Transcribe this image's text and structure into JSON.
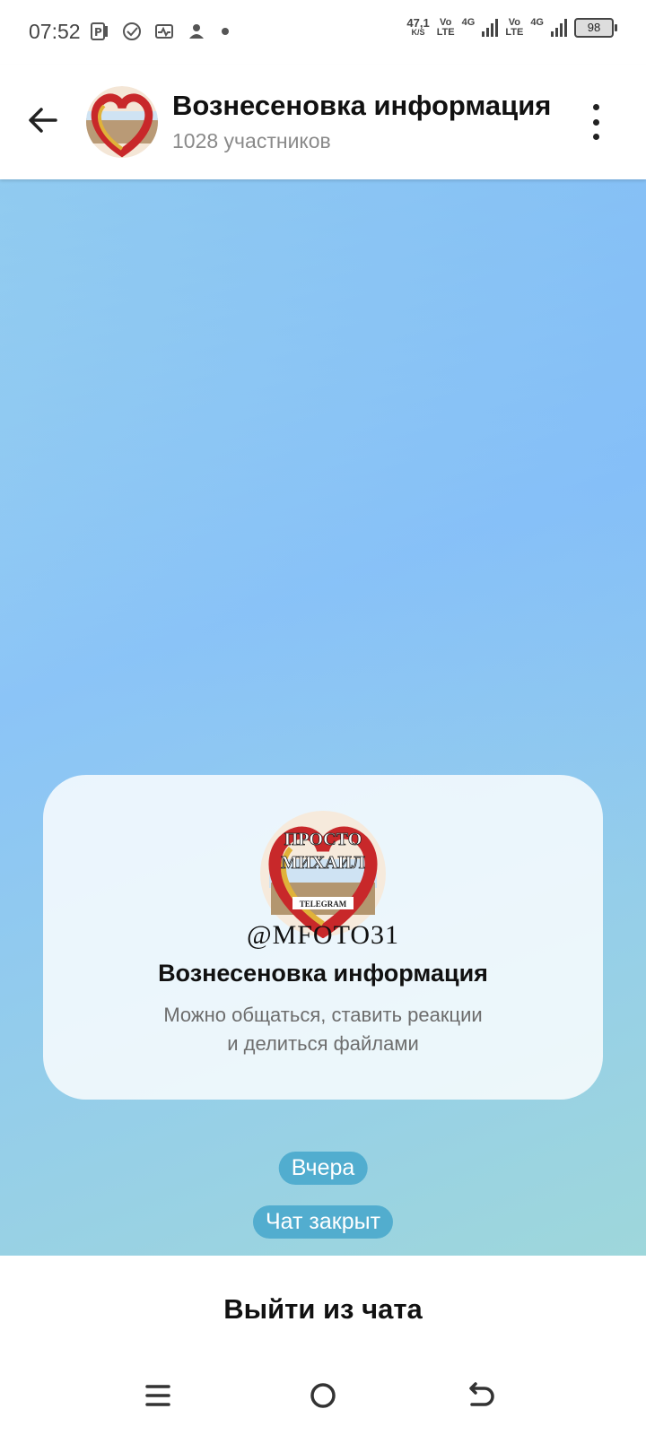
{
  "status_bar": {
    "time": "07:52",
    "net_speed_value": "47,1",
    "net_speed_unit": "K/S",
    "sim1_vo": "Vo",
    "sim1_lte": "LTE",
    "sim1_4g": "4G",
    "sim2_vo": "Vo",
    "sim2_lte": "LTE",
    "sim2_4g": "4G",
    "battery": "98"
  },
  "header": {
    "title": "Вознесеновка информация",
    "subtitle": "1028 участников"
  },
  "info_card": {
    "avatar_text_1": "ПРОСТО",
    "avatar_text_2": "МИХАИЛ",
    "avatar_text_3": "TELEGRAM",
    "handle": "@MFOTO31",
    "title": "Вознесеновка информация",
    "description_line1": "Можно общаться, ставить реакции",
    "description_line2": "и делиться файлами"
  },
  "messages": {
    "date_label": "Вчера",
    "service_label": "Чат закрыт"
  },
  "bottom": {
    "leave_label": "Выйти из чата"
  },
  "icons": {
    "back": "arrow-left-icon",
    "menu": "more-vert-icon",
    "nav_menu": "menu-icon",
    "nav_home": "home-circle-icon",
    "nav_back": "back-icon"
  },
  "colors": {
    "accent_pill": "#3aa0c8",
    "chat_bg_top": "#8bc4f7",
    "chat_bg_bottom": "#9ed7db"
  }
}
